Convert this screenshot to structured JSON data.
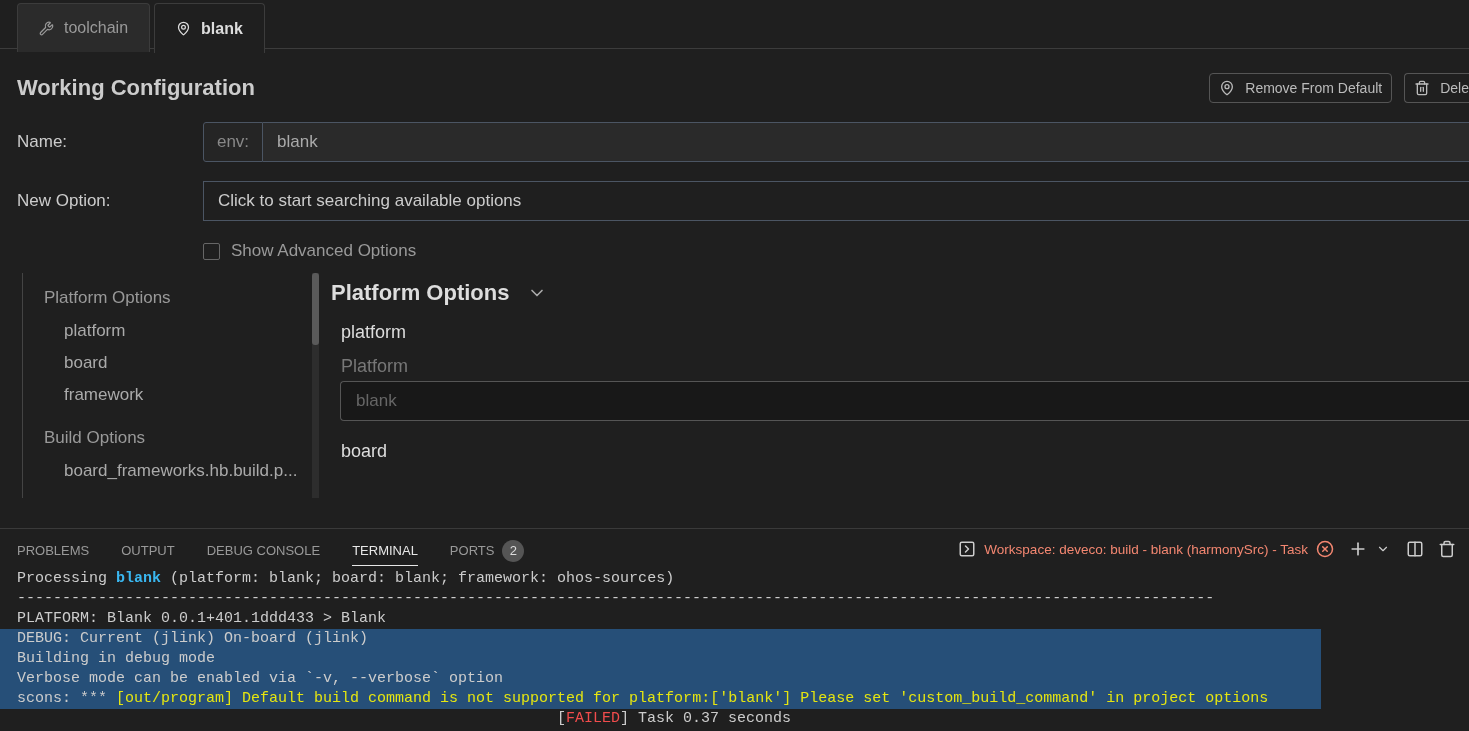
{
  "tabs": [
    {
      "label": "toolchain",
      "selected": false
    },
    {
      "label": "blank",
      "selected": true
    }
  ],
  "config": {
    "title": "Working Configuration",
    "actions": [
      {
        "label": "Remove From Default"
      },
      {
        "label": "Dele"
      }
    ],
    "name_field": {
      "label": "Name:",
      "prefix": "env:",
      "value": "blank"
    },
    "option_field": {
      "label": "New Option:",
      "placeholder": "Click to start searching available options"
    },
    "advanced": {
      "label": "Show Advanced Options",
      "checked": false
    }
  },
  "outline": [
    {
      "label": "Platform Options",
      "children": [
        {
          "label": "platform"
        },
        {
          "label": "board"
        },
        {
          "label": "framework"
        }
      ]
    },
    {
      "label": "Build Options",
      "children": [
        {
          "label": "board_frameworks.hb.build.p..."
        }
      ]
    }
  ],
  "section": {
    "title": "Platform Options",
    "expanded": true,
    "options": [
      {
        "name": "platform",
        "description": "Platform",
        "placeholder": "blank"
      },
      {
        "name": "board"
      }
    ]
  },
  "panel": {
    "tabs": [
      {
        "label": "PROBLEMS",
        "selected": false
      },
      {
        "label": "OUTPUT",
        "selected": false
      },
      {
        "label": "DEBUG CONSOLE",
        "selected": false
      },
      {
        "label": "TERMINAL",
        "selected": true
      },
      {
        "label": "PORTS",
        "badge": "2",
        "selected": false
      }
    ],
    "task": "Workspace: deveco: build - blank (harmonySrc) - Task",
    "lines": [
      {
        "kind": "processing",
        "parts": [
          "Processing ",
          "blank",
          " (platform: blank; board: blank; framework: ohos-sources)"
        ],
        "highlighted": false
      },
      {
        "kind": "plain",
        "text": "-------------------------------------------------------------------------------------------------------------------------------------",
        "highlighted": false
      },
      {
        "kind": "plain",
        "text": "PLATFORM: Blank 0.0.1+401.1ddd433 > Blank",
        "highlighted": false
      },
      {
        "kind": "plain",
        "text": "DEBUG: Current (jlink) On-board (jlink)",
        "highlighted": true
      },
      {
        "kind": "plain",
        "text": "Building in debug mode",
        "highlighted": true
      },
      {
        "kind": "plain",
        "text": "Verbose mode can be enabled via `-v, --verbose` option",
        "highlighted": true
      },
      {
        "kind": "error",
        "parts": [
          "scons: *** ",
          "[out/program] Default build command is not supported for platform:['blank'] Please set 'custom_build_command' in project options"
        ],
        "highlighted": true
      },
      {
        "kind": "status",
        "parts": [
          "[",
          "FAILED",
          "] Task 0.37 seconds"
        ],
        "highlighted": false
      }
    ]
  }
}
